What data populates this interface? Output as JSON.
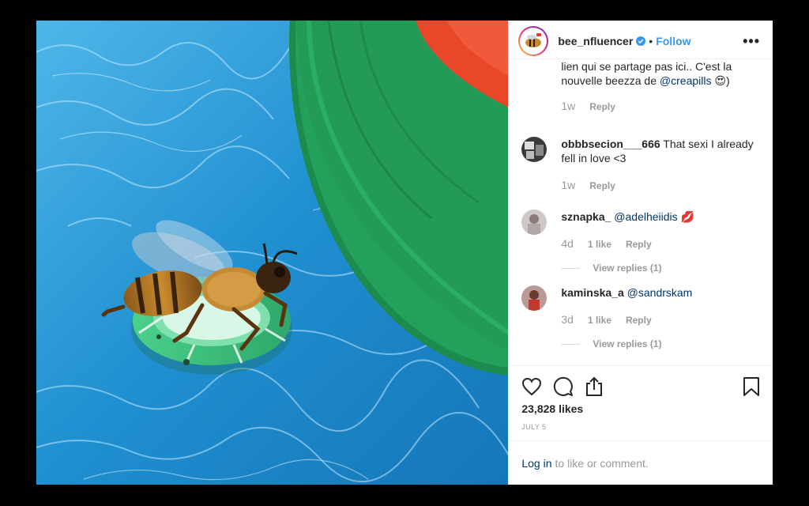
{
  "post": {
    "username": "bee_nfluencer",
    "follow_label": "Follow",
    "dot": "•",
    "more": "•••"
  },
  "comments": [
    {
      "text_partial_top": "…(lien qui se partage pas ici.. C'est la",
      "text_line1": "lien qui se partage pas ici.. C'est la",
      "text_line2": "nouvelle beezza de ",
      "mention": "@creapills",
      "emoji": "😍",
      "close": ")",
      "time": "1w",
      "reply": "Reply"
    },
    {
      "username": "obbbsecion___666",
      "text": " That sexi I already fell in love <3",
      "time": "1w",
      "reply": "Reply"
    },
    {
      "username": "sznapka_",
      "mention": "@adelheiidis",
      "emoji": "💋",
      "time": "4d",
      "likes": "1 like",
      "reply": "Reply",
      "view_replies": "View replies (1)"
    },
    {
      "username": "kaminska_a",
      "mention": "@sandrskam",
      "time": "3d",
      "likes": "1 like",
      "reply": "Reply",
      "view_replies": "View replies (1)"
    }
  ],
  "footer": {
    "likes": "23,828 likes",
    "date": "JULY 5",
    "login_link": "Log in",
    "login_rest": "to like or comment."
  },
  "icons": {
    "like": "heart-icon",
    "comment": "speech-bubble-icon",
    "share": "share-icon",
    "save": "bookmark-icon",
    "verified": "verified-badge-icon"
  },
  "colors": {
    "accent": "#3897f0",
    "mention": "#003569",
    "muted": "#999999"
  }
}
